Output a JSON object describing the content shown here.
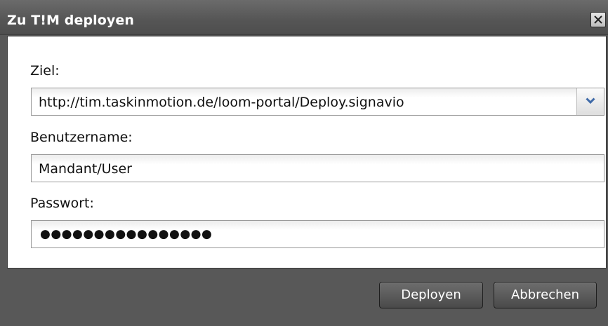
{
  "dialog": {
    "title": "Zu T!M deployen",
    "close_icon": "close-icon"
  },
  "form": {
    "ziel_label": "Ziel:",
    "ziel_value": "http://tim.taskinmotion.de/loom-portal/Deploy.signavio",
    "benutzername_label": "Benutzername:",
    "benutzername_value": "Mandant/User",
    "passwort_label": "Passwort:",
    "passwort_value": "●●●●●●●●●●●●●●●●"
  },
  "buttons": {
    "deploy_label": "Deployen",
    "cancel_label": "Abbrechen"
  },
  "colors": {
    "titlebar": "#555555",
    "footer": "#585858",
    "panel": "#ffffff"
  }
}
